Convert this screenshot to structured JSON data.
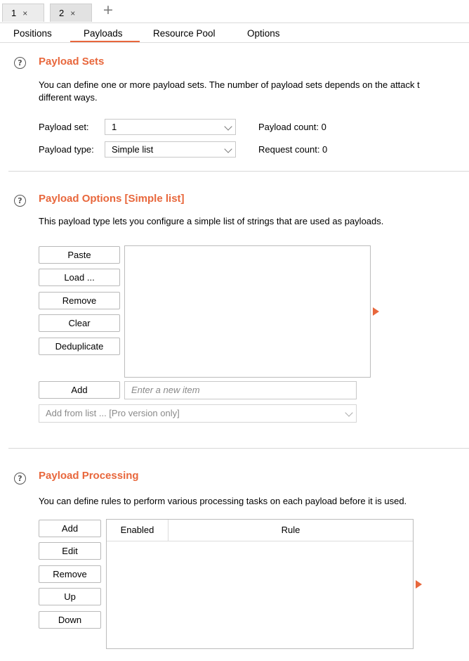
{
  "tabs": [
    {
      "label": "1",
      "close": "×"
    },
    {
      "label": "2",
      "close": "×"
    }
  ],
  "new_tab": "+",
  "subtabs": [
    "Positions",
    "Payloads",
    "Resource Pool",
    "Options"
  ],
  "active_subtab": "Payloads",
  "payload_sets": {
    "title": "Payload Sets",
    "desc_line1": "You can define one or more payload sets. The number of payload sets depends on the attack t",
    "desc_line2": "different ways.",
    "set_label": "Payload set:",
    "set_value": "1",
    "type_label": "Payload type:",
    "type_value": "Simple list",
    "payload_count": "Payload count: 0",
    "request_count": "Request count: 0"
  },
  "payload_options": {
    "title": "Payload Options [Simple list]",
    "desc": "This payload type lets you configure a simple list of strings that are used as payloads.",
    "buttons": [
      "Paste",
      "Load ...",
      "Remove",
      "Clear",
      "Deduplicate"
    ],
    "add_label": "Add",
    "add_placeholder": "Enter a new item",
    "add_from_list": "Add from list ... [Pro version only]"
  },
  "payload_processing": {
    "title": "Payload Processing",
    "desc": "You can define rules to perform various processing tasks on each payload before it is used.",
    "buttons": [
      "Add",
      "Edit",
      "Remove",
      "Up",
      "Down"
    ],
    "columns": [
      "Enabled",
      "Rule"
    ]
  },
  "help_glyph": "?",
  "colors": {
    "accent": "#e8673c",
    "border": "#bcbcbc"
  }
}
